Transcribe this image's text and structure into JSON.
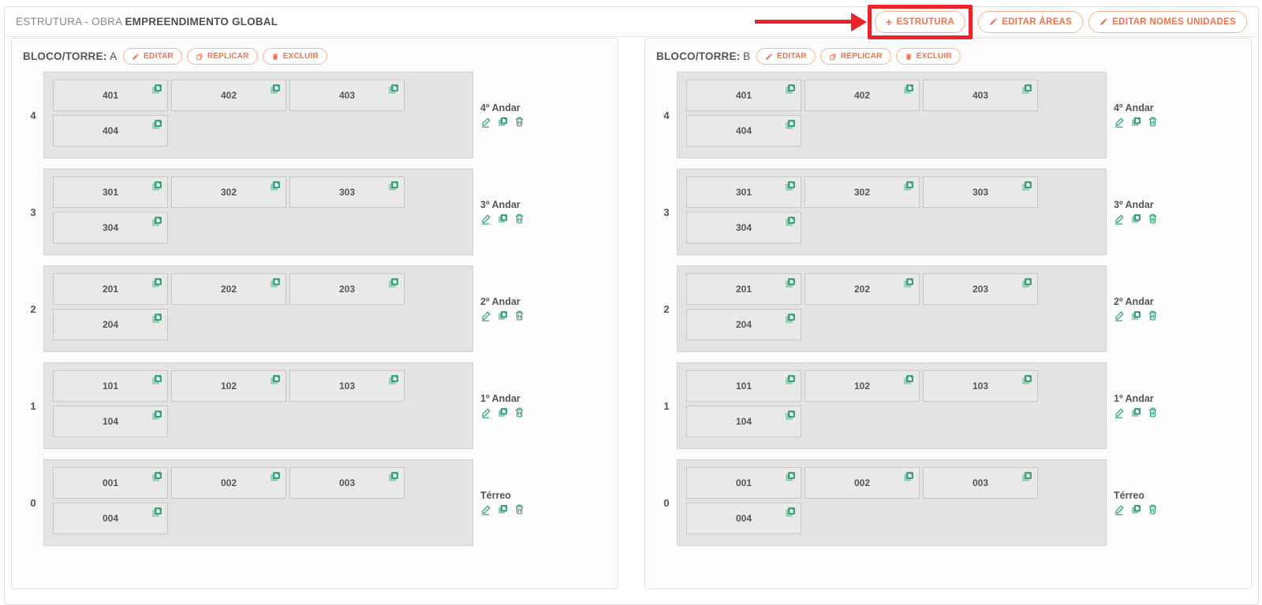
{
  "header": {
    "title_prefix": "ESTRUTURA - OBRA",
    "title_bold": "EMPREENDIMENTO GLOBAL",
    "actions": [
      {
        "icon": "plus",
        "label": "ESTRUTURA",
        "highlighted": true
      },
      {
        "icon": "pencil",
        "label": "EDITAR ÁREAS",
        "highlighted": false
      },
      {
        "icon": "pencil",
        "label": "EDITAR NOMES UNIDADES",
        "highlighted": false
      }
    ]
  },
  "colors": {
    "accent_orange": "#f0734d",
    "accent_green": "#36a374",
    "accent_green_light": "#9bcfb5",
    "annotation_red": "#e8232a"
  },
  "blocks": [
    {
      "label": "BLOCO/TORRE:",
      "name": "A",
      "buttons": [
        "EDITAR",
        "REPLICAR",
        "EXCLUIR"
      ],
      "floors": [
        {
          "number": "4",
          "label": "4º Andar",
          "unit_rows": [
            [
              "401",
              "402",
              "403"
            ],
            [
              "404"
            ]
          ]
        },
        {
          "number": "3",
          "label": "3º Andar",
          "unit_rows": [
            [
              "301",
              "302",
              "303"
            ],
            [
              "304"
            ]
          ]
        },
        {
          "number": "2",
          "label": "2º Andar",
          "unit_rows": [
            [
              "201",
              "202",
              "203"
            ],
            [
              "204"
            ]
          ]
        },
        {
          "number": "1",
          "label": "1º Andar",
          "unit_rows": [
            [
              "101",
              "102",
              "103"
            ],
            [
              "104"
            ]
          ]
        },
        {
          "number": "0",
          "label": "Térreo",
          "unit_rows": [
            [
              "001",
              "002",
              "003"
            ],
            [
              "004"
            ]
          ]
        }
      ]
    },
    {
      "label": "BLOCO/TORRE:",
      "name": "B",
      "buttons": [
        "EDITAR",
        "REPLICAR",
        "EXCLUIR"
      ],
      "floors": [
        {
          "number": "4",
          "label": "4º Andar",
          "unit_rows": [
            [
              "401",
              "402",
              "403"
            ],
            [
              "404"
            ]
          ]
        },
        {
          "number": "3",
          "label": "3º Andar",
          "unit_rows": [
            [
              "301",
              "302",
              "303"
            ],
            [
              "304"
            ]
          ]
        },
        {
          "number": "2",
          "label": "2º Andar",
          "unit_rows": [
            [
              "201",
              "202",
              "203"
            ],
            [
              "204"
            ]
          ]
        },
        {
          "number": "1",
          "label": "1º Andar",
          "unit_rows": [
            [
              "101",
              "102",
              "103"
            ],
            [
              "104"
            ]
          ]
        },
        {
          "number": "0",
          "label": "Térreo",
          "unit_rows": [
            [
              "001",
              "002",
              "003"
            ],
            [
              "004"
            ]
          ]
        }
      ]
    }
  ]
}
